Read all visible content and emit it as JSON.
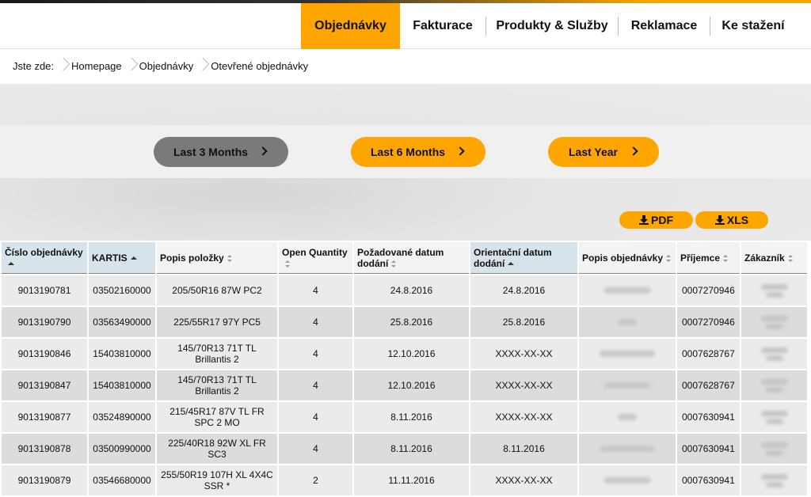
{
  "nav": {
    "items": [
      {
        "label": "Objednávky",
        "active": true
      },
      {
        "label": "Fakturace",
        "active": false
      },
      {
        "label": "Produkty & Služby",
        "active": false
      },
      {
        "label": "Reklamace",
        "active": false
      },
      {
        "label": "Ke stažení",
        "active": false
      }
    ]
  },
  "breadcrumb": {
    "prefix": "Jste zde:",
    "items": [
      "Homepage",
      "Objednávky",
      "Otevřené objednávky"
    ]
  },
  "periods": [
    {
      "label": "Last 3 Months",
      "selected": true
    },
    {
      "label": "Last 6 Months",
      "selected": false
    },
    {
      "label": "Last Year",
      "selected": false
    }
  ],
  "export": {
    "pdf": "PDF",
    "xls": "XLS"
  },
  "table": {
    "columns": [
      {
        "label": "Číslo objednávky",
        "sort": "asc",
        "highlight": true
      },
      {
        "label": "KARTIS",
        "sort": "asc",
        "highlight": true
      },
      {
        "label": "Popis položky",
        "sort": "none",
        "highlight": false
      },
      {
        "label": "Open Quantity",
        "sort": "none",
        "highlight": false
      },
      {
        "label": "Požadované datum dodání",
        "sort": "none",
        "highlight": false
      },
      {
        "label": "Orientační datum dodání",
        "sort": "asc",
        "highlight": true
      },
      {
        "label": "Popis objednávky",
        "sort": "none",
        "highlight": false
      },
      {
        "label": "Příjemce",
        "sort": "none",
        "highlight": false
      },
      {
        "label": "Zákazník",
        "sort": "none",
        "highlight": false
      }
    ],
    "rows": [
      {
        "order": "9013190781",
        "kartis": "03502160000",
        "item": "205/50R16 87W PC2",
        "qty": "4",
        "req_date": "24.8.2016",
        "est_date": "24.8.2016",
        "recipient": "0007270946"
      },
      {
        "order": "9013190790",
        "kartis": "03563490000",
        "item": "225/55R17 97Y PC5",
        "qty": "4",
        "req_date": "25.8.2016",
        "est_date": "25.8.2016",
        "recipient": "0007270946"
      },
      {
        "order": "9013190846",
        "kartis": "15403810000",
        "item": "145/70R13 71T TL Brillantis 2",
        "qty": "4",
        "req_date": "12.10.2016",
        "est_date": "XXXX-XX-XX",
        "recipient": "0007628767"
      },
      {
        "order": "9013190847",
        "kartis": "15403810000",
        "item": "145/70R13 71T TL Brillantis 2",
        "qty": "4",
        "req_date": "12.10.2016",
        "est_date": "XXXX-XX-XX",
        "recipient": "0007628767"
      },
      {
        "order": "9013190877",
        "kartis": "03524890000",
        "item": "215/45R17 87V TL FR SPC 2 MO",
        "qty": "4",
        "req_date": "8.11.2016",
        "est_date": "XXXX-XX-XX",
        "recipient": "0007630941"
      },
      {
        "order": "9013190878",
        "kartis": "03500990000",
        "item": "225/40R18 92W XL FR SC3",
        "qty": "4",
        "req_date": "8.11.2016",
        "est_date": "8.11.2016",
        "recipient": "0007630941"
      },
      {
        "order": "9013190879",
        "kartis": "03546680000",
        "item": "255/50R19 107H XL 4X4C SSR *",
        "qty": "2",
        "req_date": "11.11.2016",
        "est_date": "XXXX-XX-XX",
        "recipient": "0007630941"
      }
    ]
  },
  "colors": {
    "accent": "#ffa500",
    "selected_period": "#7a7a7a",
    "sorted_header": "#d6e3ea"
  }
}
